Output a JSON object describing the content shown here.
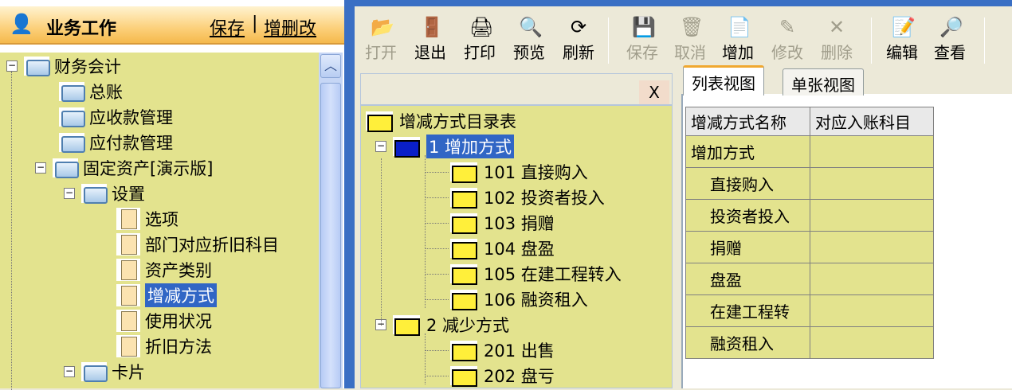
{
  "left_panel": {
    "title": "业务工作",
    "save_link": "保存",
    "edit_link": "增删改",
    "separator": "|",
    "tree": [
      {
        "label": "财务会计",
        "type": "folder",
        "level": 0,
        "expanded": true
      },
      {
        "label": "总账",
        "type": "folder",
        "level": 1
      },
      {
        "label": "应收款管理",
        "type": "folder",
        "level": 1
      },
      {
        "label": "应付款管理",
        "type": "folder",
        "level": 1
      },
      {
        "label": "固定资产[演示版]",
        "type": "folder",
        "level": 1,
        "expanded": true
      },
      {
        "label": "设置",
        "type": "folder",
        "level": 2,
        "expanded": true
      },
      {
        "label": "选项",
        "type": "doc",
        "level": 3
      },
      {
        "label": "部门对应折旧科目",
        "type": "doc",
        "level": 3
      },
      {
        "label": "资产类别",
        "type": "doc",
        "level": 3
      },
      {
        "label": "增减方式",
        "type": "doc",
        "level": 3,
        "selected": true
      },
      {
        "label": "使用状况",
        "type": "doc",
        "level": 3
      },
      {
        "label": "折旧方法",
        "type": "doc",
        "level": 3
      },
      {
        "label": "卡片",
        "type": "folder",
        "level": 2,
        "expanded": true
      }
    ]
  },
  "toolbar": [
    {
      "label": "打开",
      "icon": "open-folder-icon",
      "enabled": false
    },
    {
      "label": "退出",
      "icon": "exit-door-icon",
      "enabled": true
    },
    {
      "label": "打印",
      "icon": "printer-icon",
      "enabled": true
    },
    {
      "label": "预览",
      "icon": "preview-icon",
      "enabled": true
    },
    {
      "label": "刷新",
      "icon": "refresh-icon",
      "enabled": true
    },
    {
      "label": "保存",
      "icon": "save-disk-icon",
      "enabled": false
    },
    {
      "label": "取消",
      "icon": "cancel-trash-icon",
      "enabled": false
    },
    {
      "label": "增加",
      "icon": "add-document-icon",
      "enabled": true
    },
    {
      "label": "修改",
      "icon": "edit-pencil-icon",
      "enabled": false
    },
    {
      "label": "删除",
      "icon": "delete-x-icon",
      "enabled": false
    },
    {
      "label": "编辑",
      "icon": "edit-form-icon",
      "enabled": true
    },
    {
      "label": "查看",
      "icon": "view-magnifier-icon",
      "enabled": true
    }
  ],
  "close_label": "X",
  "middle_tree": {
    "root": "增减方式目录表",
    "groups": [
      {
        "label": "1 增加方式",
        "selected": true,
        "items": [
          "101 直接购入",
          "102 投资者投入",
          "103 捐赠",
          "104 盘盈",
          "105 在建工程转入",
          "106 融资租入"
        ]
      },
      {
        "label": "2 减少方式",
        "items": [
          "201 出售",
          "202 盘亏"
        ]
      }
    ]
  },
  "tabs": [
    "列表视图",
    "单张视图"
  ],
  "table": {
    "headers": [
      "增减方式名称",
      "对应入账科目"
    ],
    "rows": [
      [
        "增加方式",
        ""
      ],
      [
        "直接购入",
        ""
      ],
      [
        "投资者投入",
        ""
      ],
      [
        "捐赠",
        ""
      ],
      [
        "盘盈",
        ""
      ],
      [
        "在建工程转",
        ""
      ],
      [
        "融资租入",
        ""
      ]
    ]
  }
}
